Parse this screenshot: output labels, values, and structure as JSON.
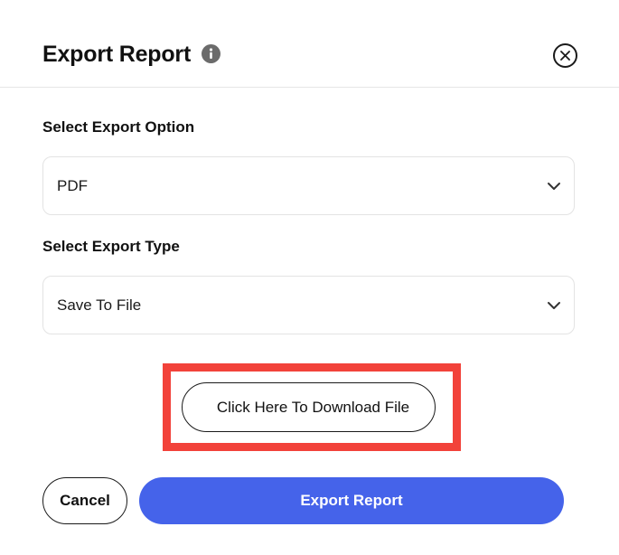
{
  "dialog": {
    "title": "Export Report",
    "icons": {
      "info": "info-icon",
      "close": "close-icon"
    }
  },
  "export_option": {
    "label": "Select Export Option",
    "selected": "PDF"
  },
  "export_type": {
    "label": "Select Export Type",
    "selected": "Save To File"
  },
  "download": {
    "label": "Click Here To Download File",
    "highlight_color": "#f2423a"
  },
  "footer": {
    "cancel_label": "Cancel",
    "export_label": "Export Report"
  },
  "colors": {
    "primary": "#4563ea",
    "text": "#111111",
    "border": "#e3e3e3"
  }
}
